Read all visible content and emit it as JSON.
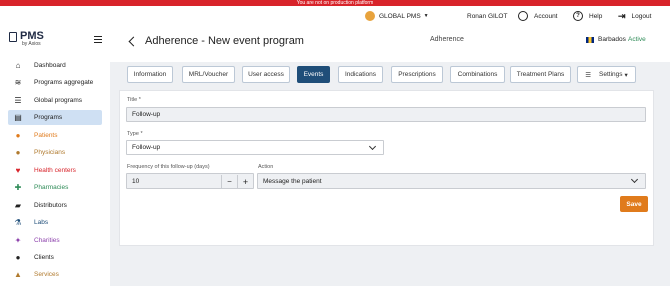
{
  "banner": {
    "text": "You are not on production platform"
  },
  "topbar": {
    "program": "GLOBAL PMS",
    "user": "Ronan GILOT",
    "account": "Account",
    "help": "Help",
    "logout": "Logout"
  },
  "sidebar": {
    "logo_title": "PMS",
    "logo_sub": "by Axios",
    "items": [
      {
        "label": "Dashboard",
        "icon": "home-icon",
        "color": "#222222"
      },
      {
        "label": "Programs aggregate",
        "icon": "layers-icon",
        "color": "#222222"
      },
      {
        "label": "Global programs",
        "icon": "list-icon",
        "color": "#222222"
      },
      {
        "label": "Programs",
        "icon": "clipboard-icon",
        "color": "#222222"
      },
      {
        "label": "Patients",
        "icon": "patient-icon",
        "color": "#e07b1c"
      },
      {
        "label": "Physicians",
        "icon": "physician-icon",
        "color": "#b07a2e"
      },
      {
        "label": "Health centers",
        "icon": "heart-icon",
        "color": "#d8232a"
      },
      {
        "label": "Pharmacies",
        "icon": "pharmacy-icon",
        "color": "#2e8b57"
      },
      {
        "label": "Distributors",
        "icon": "truck-icon",
        "color": "#222222"
      },
      {
        "label": "Labs",
        "icon": "flask-icon",
        "color": "#1f4e79"
      },
      {
        "label": "Charities",
        "icon": "charity-icon",
        "color": "#8e44ad"
      },
      {
        "label": "Clients",
        "icon": "client-icon",
        "color": "#222222"
      },
      {
        "label": "Services",
        "icon": "services-icon",
        "color": "#b07a2e"
      }
    ]
  },
  "header": {
    "title": "Adherence - New event program",
    "program_type": "Adherence",
    "country": "Barbados",
    "status": "Active"
  },
  "tabs": [
    {
      "label": "Information"
    },
    {
      "label": "MRL/Voucher"
    },
    {
      "label": "User access"
    },
    {
      "label": "Events"
    },
    {
      "label": "Indications"
    },
    {
      "label": "Prescriptions"
    },
    {
      "label": "Combinations"
    },
    {
      "label": "Treatment Plans"
    },
    {
      "label": "Settings"
    }
  ],
  "form": {
    "title_label": "Title *",
    "title_value": "Follow-up",
    "type_label": "Type *",
    "type_value": "Follow-up",
    "freq_label": "Frequency of this follow-up (days)",
    "freq_value": "10",
    "minus": "−",
    "plus": "+",
    "action_label": "Action",
    "action_value": "Message the patient",
    "save": "Save"
  },
  "colors": {
    "accent": "#1f4e79",
    "save": "#e07b1c",
    "active_status": "#2e8b57",
    "banner": "#d8232a"
  }
}
